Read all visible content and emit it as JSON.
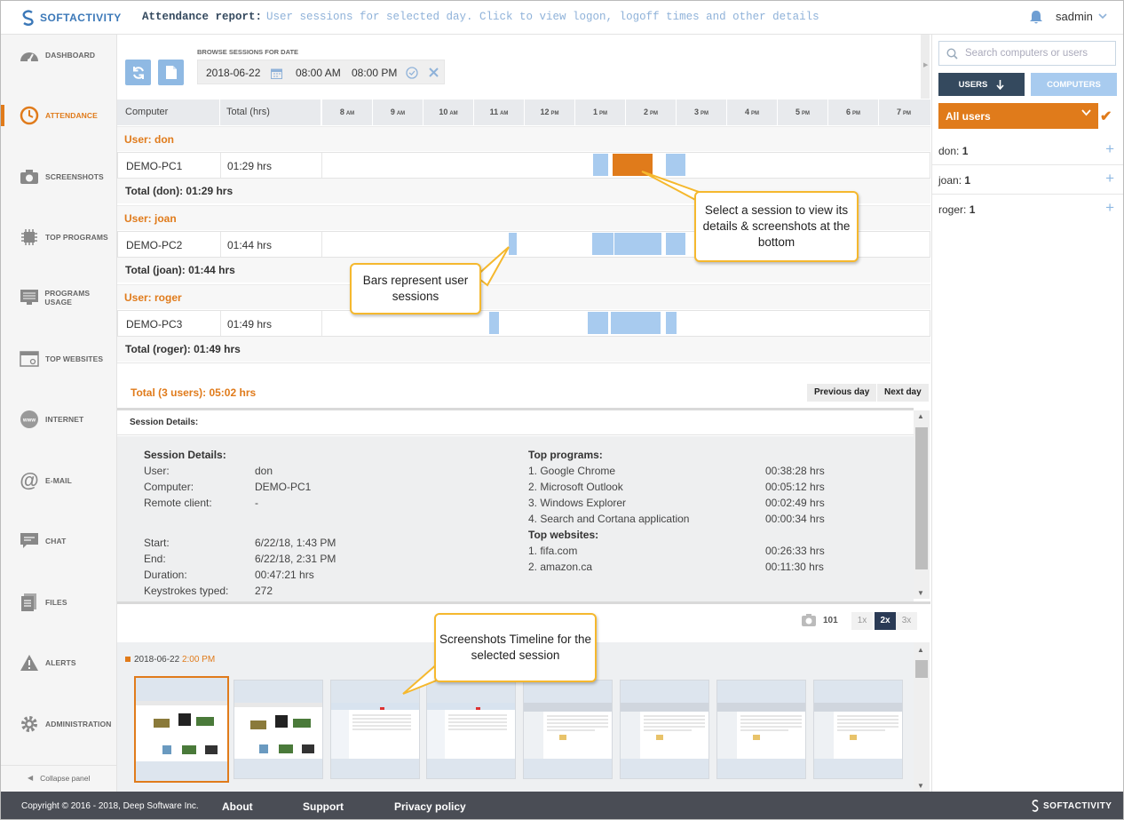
{
  "brand": {
    "name": "SOFTACTIVITY"
  },
  "header": {
    "title": "Attendance report:",
    "subtitle": "User sessions for selected day. Click to view logon, logoff times and other details",
    "user": "sadmin"
  },
  "sidebar": {
    "items": [
      {
        "label": "DASHBOARD",
        "icon": "dashboard-icon"
      },
      {
        "label": "ATTENDANCE",
        "icon": "clock-icon",
        "active": true
      },
      {
        "label": "SCREENSHOTS",
        "icon": "camera-icon"
      },
      {
        "label": "TOP PROGRAMS",
        "icon": "chip-icon"
      },
      {
        "label": "PROGRAMS USAGE",
        "icon": "monitor-icon"
      },
      {
        "label": "TOP WEBSITES",
        "icon": "browser-icon"
      },
      {
        "label": "INTERNET",
        "icon": "www-icon"
      },
      {
        "label": "E-MAIL",
        "icon": "at-icon"
      },
      {
        "label": "CHAT",
        "icon": "chat-icon"
      },
      {
        "label": "FILES",
        "icon": "files-icon"
      },
      {
        "label": "ALERTS",
        "icon": "alert-icon"
      },
      {
        "label": "ADMINISTRATION",
        "icon": "gear-icon"
      }
    ],
    "collapse": "Collapse panel"
  },
  "toolbar": {
    "browse_label": "BROWSE SESSIONS FOR DATE",
    "date": "2018-06-22",
    "start": "08:00 AM",
    "end": "08:00 PM"
  },
  "grid": {
    "col_computer": "Computer",
    "col_total": "Total (hrs)",
    "hours": [
      {
        "h": "8",
        "ap": "AM"
      },
      {
        "h": "9",
        "ap": "AM"
      },
      {
        "h": "10",
        "ap": "AM"
      },
      {
        "h": "11",
        "ap": "AM"
      },
      {
        "h": "12",
        "ap": "PM"
      },
      {
        "h": "1",
        "ap": "PM"
      },
      {
        "h": "2",
        "ap": "PM"
      },
      {
        "h": "3",
        "ap": "PM"
      },
      {
        "h": "4",
        "ap": "PM"
      },
      {
        "h": "5",
        "ap": "PM"
      },
      {
        "h": "6",
        "ap": "PM"
      },
      {
        "h": "7",
        "ap": "PM"
      }
    ],
    "users": [
      {
        "header": "User: don",
        "computer": "DEMO-PC1",
        "total": "01:29 hrs",
        "footer": "Total (don): 01:29 hrs"
      },
      {
        "header": "User: joan",
        "computer": "DEMO-PC2",
        "total": "01:44 hrs",
        "footer": "Total (joan): 01:44 hrs"
      },
      {
        "header": "User: roger",
        "computer": "DEMO-PC3",
        "total": "01:49 hrs",
        "footer": "Total (roger): 01:49 hrs"
      }
    ],
    "grand_total": "Total (3 users): 05:02 hrs",
    "prev_day": "Previous day",
    "next_day": "Next day"
  },
  "session": {
    "panel_title": "Session Details:",
    "section_title": "Session Details:",
    "user_label": "User:",
    "user": "don",
    "computer_label": "Computer:",
    "computer": "DEMO-PC1",
    "remote_label": "Remote client:",
    "remote": "-",
    "start_label": "Start:",
    "start": "6/22/18, 1:43 PM",
    "end_label": "End:",
    "end": "6/22/18, 2:31 PM",
    "duration_label": "Duration:",
    "duration": "00:47:21 hrs",
    "keys_label": "Keystrokes typed:",
    "keys": "272",
    "programs_title": "Top programs:",
    "programs": [
      {
        "name": "1. Google Chrome",
        "time": "00:38:28 hrs"
      },
      {
        "name": "2. Microsoft Outlook",
        "time": "00:05:12 hrs"
      },
      {
        "name": "3. Windows Explorer",
        "time": "00:02:49 hrs"
      },
      {
        "name": "4. Search and Cortana application",
        "time": "00:00:34 hrs"
      }
    ],
    "websites_title": "Top websites:",
    "websites": [
      {
        "name": "1. fifa.com",
        "time": "00:26:33 hrs"
      },
      {
        "name": "2. amazon.ca",
        "time": "00:11:30 hrs"
      }
    ]
  },
  "screenshots": {
    "count": "101",
    "zoom": [
      "1x",
      "2x",
      "3x"
    ],
    "zoom_active": "2x",
    "date": "2018-06-22",
    "time": "2:00 PM"
  },
  "right": {
    "search_placeholder": "Search computers or users",
    "tab_users": "USERS",
    "tab_computers": "COMPUTERS",
    "filter": "All users",
    "users": [
      {
        "name": "don:",
        "count": "1"
      },
      {
        "name": "joan:",
        "count": "1"
      },
      {
        "name": "roger:",
        "count": "1"
      }
    ]
  },
  "footer": {
    "copyright": "Copyright © 2016 - 2018, Deep Software Inc.",
    "about": "About",
    "support": "Support",
    "privacy": "Privacy policy",
    "brand": "SOFTACTIVITY"
  },
  "callouts": {
    "session": "Select a session to view its details & screenshots at the bottom",
    "bars": "Bars represent user sessions",
    "timeline": "Screenshots Timeline for the selected session"
  },
  "colors": {
    "accent": "#e07b1b",
    "primary": "#34495e",
    "bar": "#a8cbef"
  }
}
